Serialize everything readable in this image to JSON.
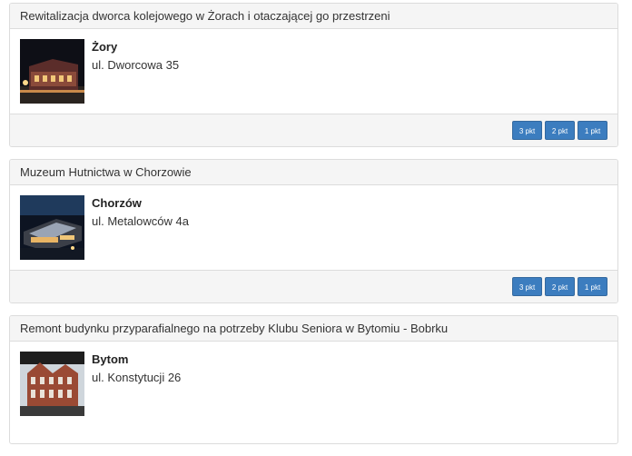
{
  "entries": [
    {
      "title": "Rewitalizacja dworca kolejowego w Żorach i otaczającej go przestrzeni",
      "city": "Żory",
      "street": "ul. Dworcowa 35",
      "image": "station-night-photo",
      "buttons": [
        "3 pkt",
        "2 pkt",
        "1 pkt"
      ]
    },
    {
      "title": "Muzeum Hutnictwa w Chorzowie",
      "city": "Chorzów",
      "street": "ul. Metalowców 4a",
      "image": "museum-aerial-night-photo",
      "buttons": [
        "3 pkt",
        "2 pkt",
        "1 pkt"
      ]
    },
    {
      "title": "Remont budynku przyparafialnego na potrzeby Klubu Seniora w Bytomiu - Bobrku",
      "city": "Bytom",
      "street": "ul. Konstytucji 26",
      "image": "brick-building-photo"
    }
  ]
}
